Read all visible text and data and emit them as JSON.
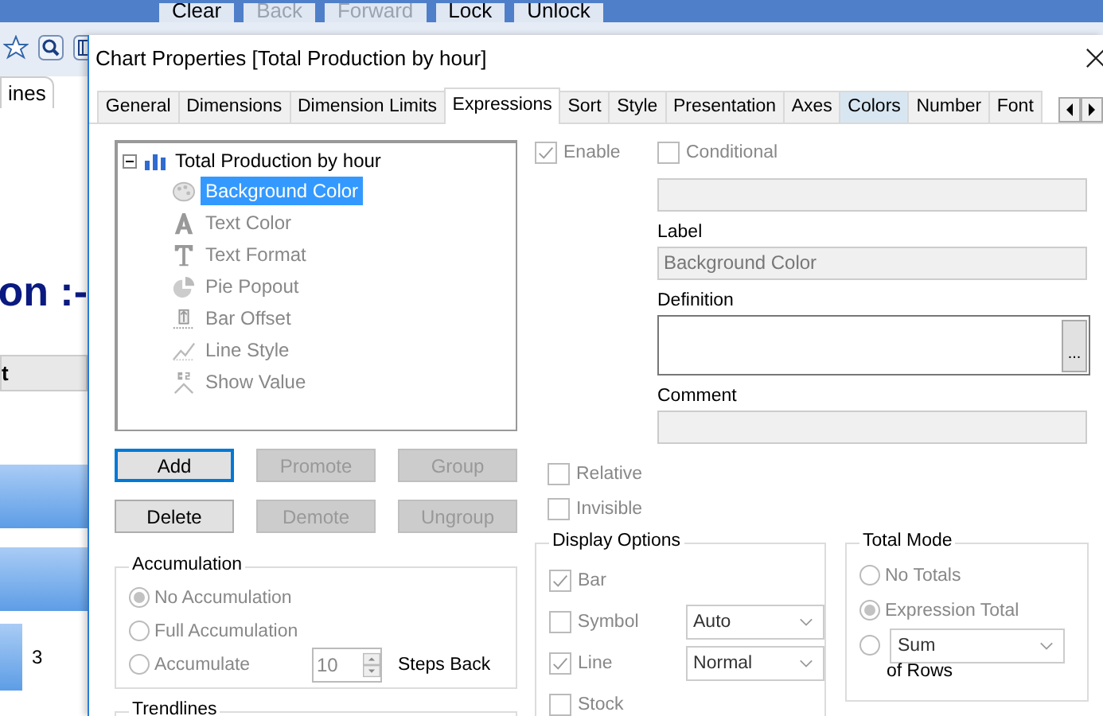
{
  "app_toolbar": {
    "items": [
      {
        "label": "Clear",
        "disabled": false
      },
      {
        "label": "Back",
        "disabled": true
      },
      {
        "label": "Forward",
        "disabled": true
      },
      {
        "label": "Lock",
        "disabled": false
      },
      {
        "label": "Unlock",
        "disabled": false
      }
    ]
  },
  "background_sheet": {
    "tab": "ines",
    "heading": "on :-",
    "column_header": "t",
    "value": "3"
  },
  "dialog": {
    "title": "Chart Properties [Total Production by hour]"
  },
  "tabs": [
    {
      "label": "General",
      "selected": false,
      "hovered": false
    },
    {
      "label": "Dimensions",
      "selected": false,
      "hovered": false
    },
    {
      "label": "Dimension Limits",
      "selected": false,
      "hovered": false
    },
    {
      "label": "Expressions",
      "selected": true,
      "hovered": false
    },
    {
      "label": "Sort",
      "selected": false,
      "hovered": false
    },
    {
      "label": "Style",
      "selected": false,
      "hovered": false
    },
    {
      "label": "Presentation",
      "selected": false,
      "hovered": false
    },
    {
      "label": "Axes",
      "selected": false,
      "hovered": false
    },
    {
      "label": "Colors",
      "selected": false,
      "hovered": true
    },
    {
      "label": "Number",
      "selected": false,
      "hovered": false
    },
    {
      "label": "Font",
      "selected": false,
      "hovered": false
    }
  ],
  "expression_tree": {
    "label": "Total Production by hour",
    "expanded": true,
    "children": [
      {
        "label": "Background Color",
        "kind": "palette",
        "selected": true
      },
      {
        "label": "Text Color",
        "kind": "text-color",
        "selected": false
      },
      {
        "label": "Text Format",
        "kind": "text-format",
        "selected": false
      },
      {
        "label": "Pie Popout",
        "kind": "pie",
        "selected": false
      },
      {
        "label": "Bar Offset",
        "kind": "bar-offset",
        "selected": false
      },
      {
        "label": "Line Style",
        "kind": "line-style",
        "selected": false
      },
      {
        "label": "Show Value",
        "kind": "show-value",
        "selected": false
      }
    ]
  },
  "buttons": [
    {
      "label": "Add",
      "disabled": false,
      "focused": true
    },
    {
      "label": "Promote",
      "disabled": true,
      "focused": false
    },
    {
      "label": "Group",
      "disabled": true,
      "focused": false
    },
    {
      "label": "Delete",
      "disabled": false,
      "focused": false
    },
    {
      "label": "Demote",
      "disabled": true,
      "focused": false
    },
    {
      "label": "Ungroup",
      "disabled": true,
      "focused": false
    }
  ],
  "accumulation": {
    "title": "Accumulation",
    "options": [
      {
        "label": "No Accumulation",
        "selected": true
      },
      {
        "label": "Full Accumulation",
        "selected": false
      },
      {
        "label": "Accumulate",
        "selected": false
      }
    ],
    "steps": "10",
    "steps_label": "Steps Back"
  },
  "trendlines": {
    "title": "Trendlines"
  },
  "enable": {
    "label": "Enable",
    "checked": true
  },
  "conditional": {
    "label": "Conditional",
    "checked": false
  },
  "label_field": {
    "label": "Label",
    "value": "Background Color"
  },
  "definition": {
    "label": "Definition",
    "button": "..."
  },
  "comment": {
    "label": "Comment"
  },
  "flags": [
    {
      "label": "Relative",
      "checked": false
    },
    {
      "label": "Invisible",
      "checked": false
    }
  ],
  "display_options": {
    "title": "Display Options",
    "items": [
      {
        "label": "Bar",
        "checked": true
      },
      {
        "label": "Symbol",
        "checked": false,
        "dropdown": "Auto"
      },
      {
        "label": "Line",
        "checked": true,
        "dropdown": "Normal"
      },
      {
        "label": "Stock",
        "checked": false
      }
    ]
  },
  "total_mode": {
    "title": "Total Mode",
    "options": [
      {
        "kind": "text",
        "label": "No Totals",
        "selected": false
      },
      {
        "kind": "text",
        "label": "Expression Total",
        "selected": true
      },
      {
        "kind": "dropdown",
        "label": "Sum",
        "selected": false
      }
    ],
    "suffix": "of Rows"
  }
}
